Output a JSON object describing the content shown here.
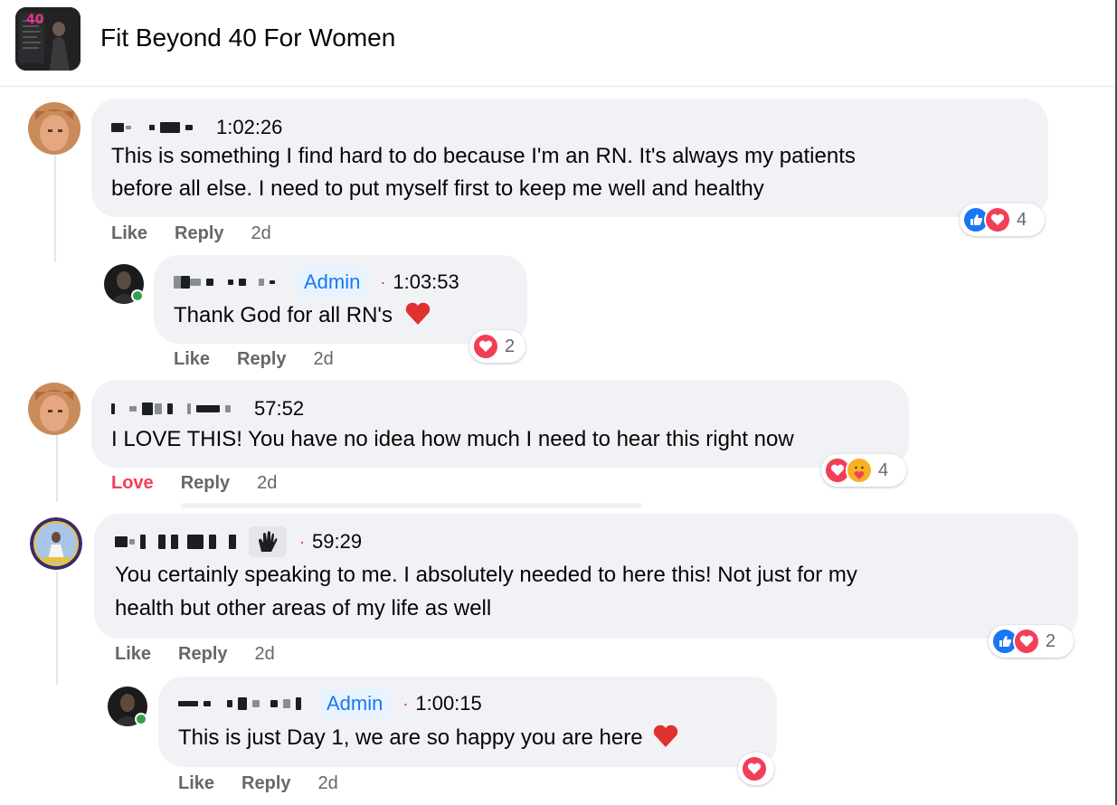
{
  "group": {
    "title": "Fit Beyond 40 For Women",
    "avatar_badge": "40"
  },
  "comments": [
    {
      "id": "c1",
      "time": "1:02:26",
      "text_line1": "This is something I find hard to do because I'm an RN. It's always my patients",
      "text_line2": "before all else. I need to put myself first to keep me well and healthy",
      "actions": {
        "like": "Like",
        "reply": "Reply",
        "age": "2d"
      },
      "reactions": {
        "icons": [
          "like-icon",
          "love-icon"
        ],
        "count": "4"
      }
    },
    {
      "id": "c1r1",
      "admin_label": "Admin",
      "time": "1:03:53",
      "text": "Thank God for all RN's",
      "actions": {
        "like": "Like",
        "reply": "Reply",
        "age": "2d"
      },
      "reactions": {
        "icons": [
          "love-icon"
        ],
        "count": "2"
      }
    },
    {
      "id": "c2",
      "time": "57:52",
      "text": "I LOVE THIS! You have no idea how much I need to hear this right now",
      "actions": {
        "like": "Love",
        "reply": "Reply",
        "age": "2d"
      },
      "reactions": {
        "icons": [
          "love-icon",
          "care-icon"
        ],
        "count": "4"
      }
    },
    {
      "id": "c3",
      "time": "59:29",
      "text_line1": "You certainly speaking to me. I absolutely needed to here this! Not just for my",
      "text_line2": "health but other areas of my life as well",
      "actions": {
        "like": "Like",
        "reply": "Reply",
        "age": "2d"
      },
      "reactions": {
        "icons": [
          "like-icon",
          "love-icon"
        ],
        "count": "2"
      }
    },
    {
      "id": "c3r1",
      "admin_label": "Admin",
      "time": "1:00:15",
      "text": "This is just Day 1, we are so happy you are here",
      "actions": {
        "like": "Like",
        "reply": "Reply",
        "age": "2d"
      },
      "reactions": {
        "icons": [
          "love-icon"
        ],
        "count": ""
      }
    }
  ],
  "colors": {
    "bubble": "#f0f2f5",
    "admin_badge_bg": "#e7f3ff",
    "admin_badge_text": "#1877f2",
    "like_blue": "#1877f2",
    "love_red": "#f33e58",
    "online_green": "#31a24c",
    "muted_text": "#65676b"
  }
}
